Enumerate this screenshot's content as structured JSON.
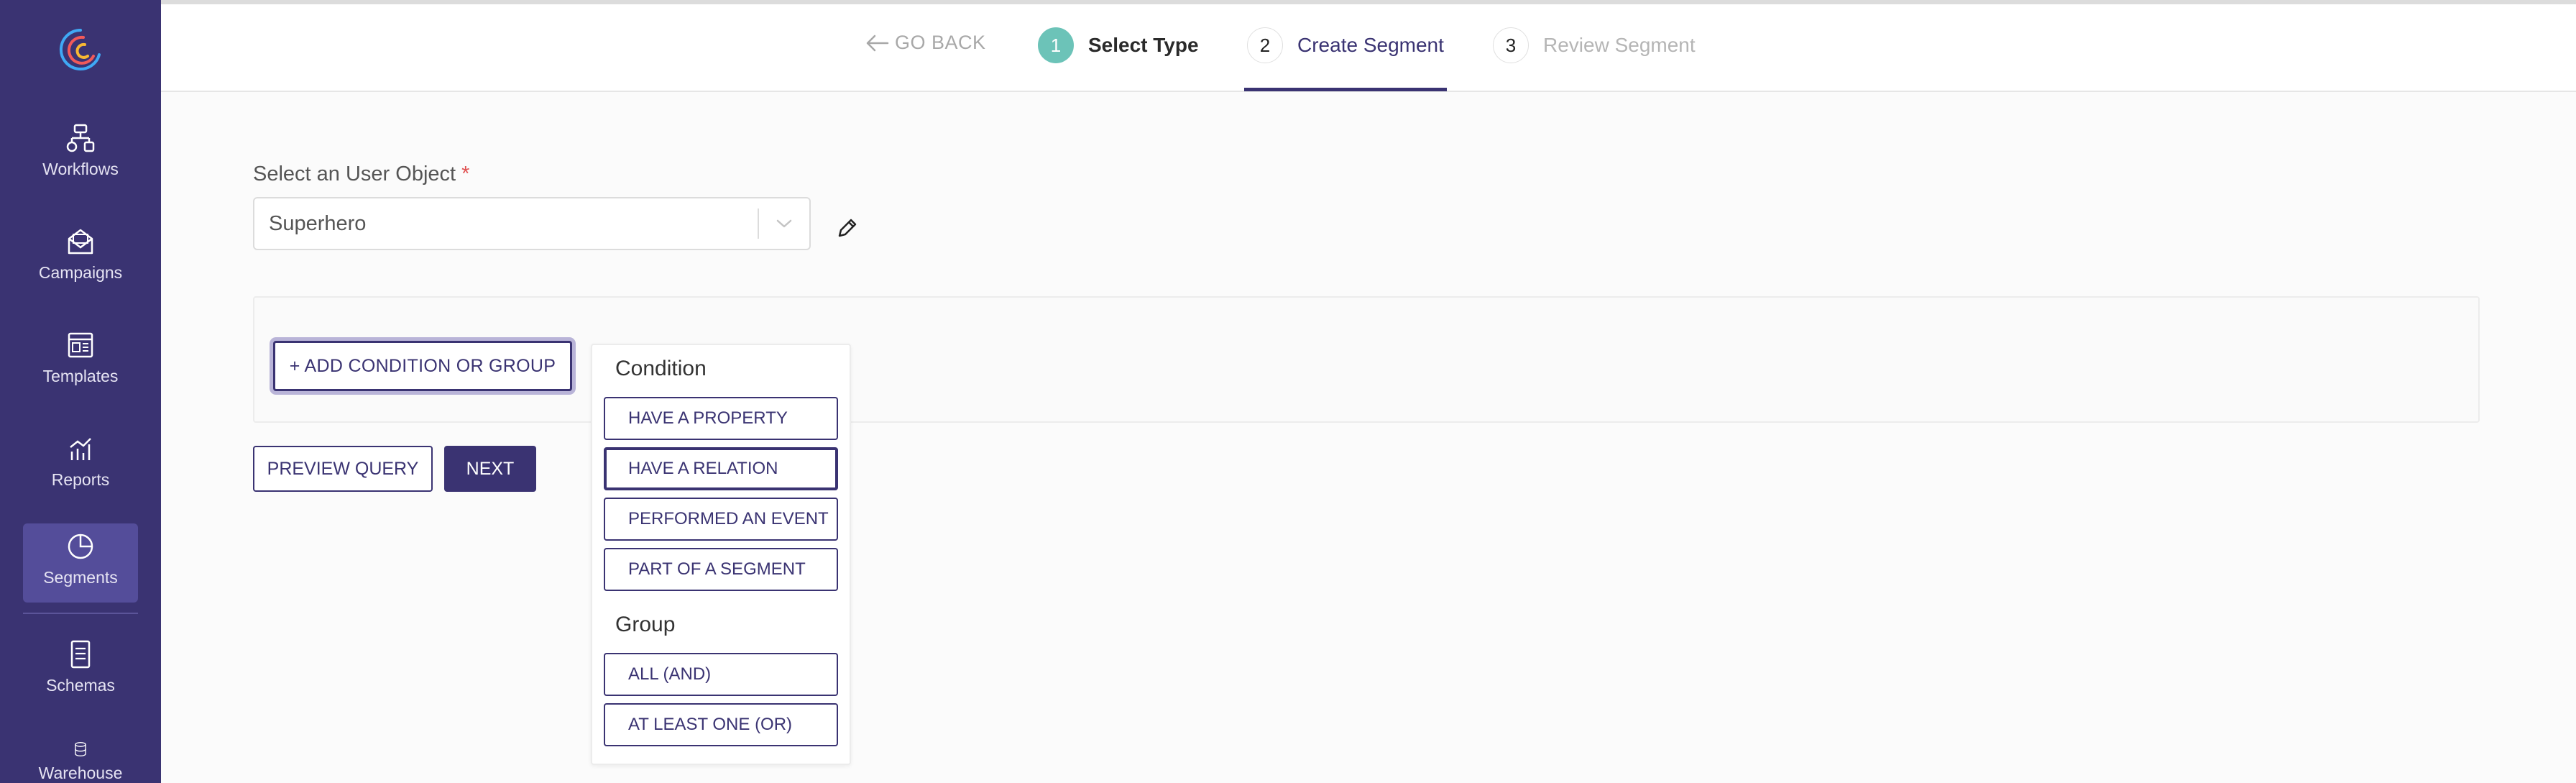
{
  "sidebar": {
    "logo": "brand-logo",
    "items": [
      {
        "label": "Workflows",
        "icon": "workflow-icon"
      },
      {
        "label": "Campaigns",
        "icon": "envelope-icon"
      },
      {
        "label": "Templates",
        "icon": "template-icon"
      },
      {
        "label": "Reports",
        "icon": "chart-icon"
      },
      {
        "label": "Segments",
        "icon": "pie-icon",
        "active": true
      },
      {
        "label": "Schemas",
        "icon": "document-icon"
      },
      {
        "label": "Warehouse",
        "icon": "database-icon"
      }
    ]
  },
  "header": {
    "go_back": "GO BACK",
    "steps": [
      {
        "number": "1",
        "label": "Select Type",
        "state": "completed"
      },
      {
        "number": "2",
        "label": "Create Segment",
        "state": "active"
      },
      {
        "number": "3",
        "label": "Review Segment",
        "state": "upcoming"
      }
    ]
  },
  "form": {
    "user_object_label": "Select an User Object",
    "required_mark": "*",
    "user_object_value": "Superhero"
  },
  "conditions": {
    "add_button": "+ ADD CONDITION OR GROUP"
  },
  "actions": {
    "preview": "PREVIEW QUERY",
    "next": "NEXT"
  },
  "dropdown": {
    "condition_heading": "Condition",
    "condition_items": [
      "HAVE A PROPERTY",
      "HAVE A RELATION",
      "PERFORMED AN EVENT",
      "PART OF A SEGMENT"
    ],
    "group_heading": "Group",
    "group_items": [
      "ALL (AND)",
      "AT LEAST ONE (OR)"
    ]
  },
  "colors": {
    "sidebar_bg": "#3a3372",
    "sidebar_active": "#544d9a",
    "accent": "#3a3372",
    "step_complete": "#6cc3b8",
    "required": "#e05252"
  }
}
